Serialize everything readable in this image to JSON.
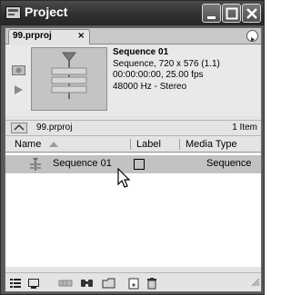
{
  "window": {
    "title": "Project"
  },
  "tab": {
    "label": "99.prproj",
    "close_glyph": "×"
  },
  "preview": {
    "name": "Sequence 01",
    "line1": "Sequence, 720 x 576 (1.1)",
    "line2": "00:00:00:00, 25.00 fps",
    "line3": "48000 Hz - Stereo"
  },
  "pathbar": {
    "path": "99.prproj",
    "count": "1 Item"
  },
  "table": {
    "headers": {
      "name": "Name",
      "label": "Label",
      "type": "Media Type"
    },
    "rows": [
      {
        "name": "Sequence 01",
        "type": "Sequence"
      }
    ]
  },
  "colors": {
    "titlebar": "#303030",
    "panel": "#e4e4e4",
    "selected_row": "#c2c2c2"
  },
  "icons": {
    "app": "premiere-project-icon",
    "bottom_toolbar": [
      "list-view-icon",
      "icon-view-icon",
      "automate-to-sequence-icon",
      "find-icon",
      "new-bin-icon",
      "new-item-icon",
      "clear-icon"
    ]
  }
}
